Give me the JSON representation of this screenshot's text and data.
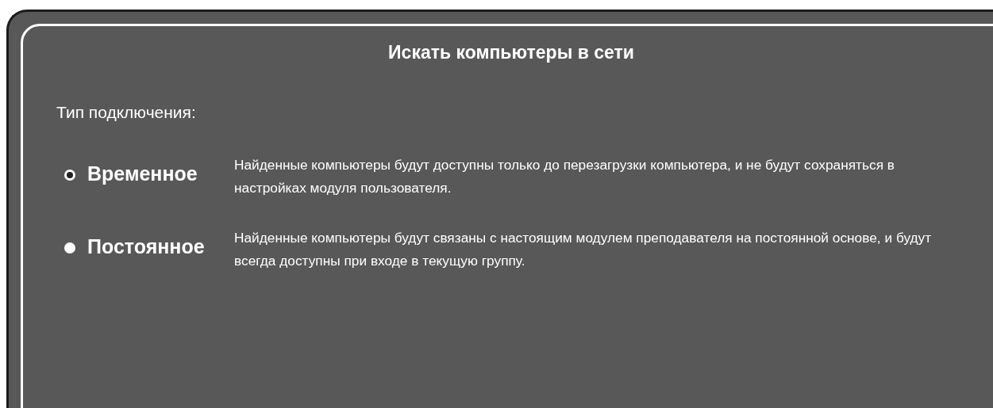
{
  "dialog": {
    "title": "Искать компьютеры в сети",
    "section_label": "Тип подключения:",
    "options": [
      {
        "label": "Временное",
        "description": "Найденные компьютеры будут доступны только до перезагрузки компьютера, и не будут сохраняться в настройках модуля пользователя.",
        "selected": true
      },
      {
        "label": "Постоянное",
        "description": "Найденные компьютеры будут связаны с настоящим модулем преподавателя на постоянной основе, и будут всегда доступны при входе в текущую группу.",
        "selected": false
      }
    ]
  }
}
